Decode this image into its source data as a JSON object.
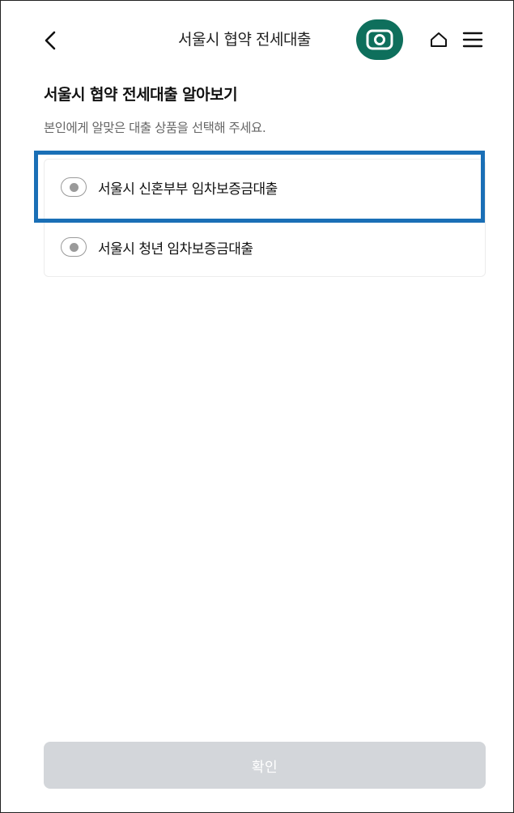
{
  "header": {
    "title": "서울시 협약 전세대출",
    "back_icon": "chevron-left-icon",
    "camera_icon": "camera-icon",
    "home_icon": "home-icon",
    "menu_icon": "hamburger-menu-icon",
    "camera_button_color": "#0e6f5c"
  },
  "main": {
    "title": "서울시 협약 전세대출 알아보기",
    "subtitle": "본인에게 알맞은 대출 상품을 선택해 주세요.",
    "options": [
      {
        "label": "서울시 신혼부부 임차보증금대출",
        "selected": false,
        "highlighted": true
      },
      {
        "label": "서울시 청년 임차보증금대출",
        "selected": false,
        "highlighted": false
      }
    ],
    "highlight_color": "#1a6fb6"
  },
  "footer": {
    "confirm_label": "확인",
    "confirm_enabled": false,
    "confirm_color": "#d3d6da"
  }
}
